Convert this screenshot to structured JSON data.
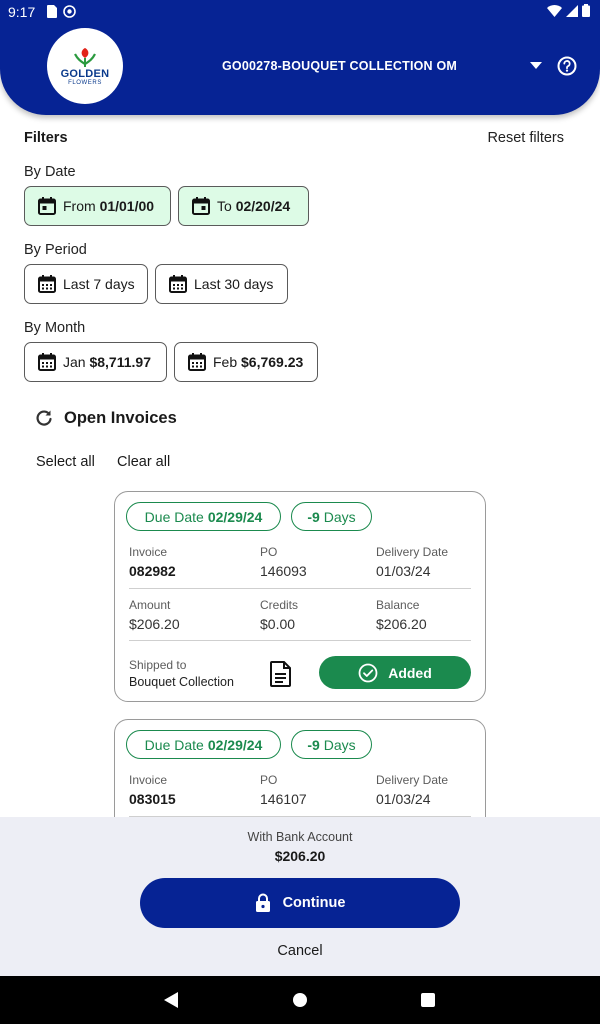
{
  "status_bar": {
    "time": "9:17"
  },
  "header": {
    "logo_line1": "GOLDEN",
    "logo_line2": "FLOWERS",
    "account_title": "GO00278-BOUQUET COLLECTION OM"
  },
  "filters": {
    "title": "Filters",
    "reset_label": "Reset filters",
    "by_date_label": "By Date",
    "date_from_prefix": "From",
    "date_from_value": "01/01/00",
    "date_to_prefix": "To",
    "date_to_value": "02/20/24",
    "by_period_label": "By Period",
    "period_7": "Last 7 days",
    "period_30": "Last 30 days",
    "by_month_label": "By Month",
    "month_jan_name": "Jan",
    "month_jan_amount": "$8,711.97",
    "month_feb_name": "Feb",
    "month_feb_amount": "$6,769.23"
  },
  "invoices_section": {
    "title": "Open Invoices",
    "select_all": "Select all",
    "clear_all": "Clear all"
  },
  "invoices": [
    {
      "due_prefix": "Due Date",
      "due_date": "02/29/24",
      "days": "-9",
      "days_label": "Days",
      "invoice_label": "Invoice",
      "invoice": "082982",
      "po_label": "PO",
      "po": "146093",
      "delivery_label": "Delivery Date",
      "delivery": "01/03/24",
      "amount_label": "Amount",
      "amount": "$206.20",
      "credits_label": "Credits",
      "credits": "$0.00",
      "balance_label": "Balance",
      "balance": "$206.20",
      "shipped_label": "Shipped to",
      "shipped_to": "Bouquet Collection",
      "action_label": "Added"
    },
    {
      "due_prefix": "Due Date",
      "due_date": "02/29/24",
      "days": "-9",
      "days_label": "Days",
      "invoice_label": "Invoice",
      "invoice": "083015",
      "po_label": "PO",
      "po": "146107",
      "delivery_label": "Delivery Date",
      "delivery": "01/03/24"
    }
  ],
  "footer": {
    "payment_method": "With Bank Account",
    "total": "$206.20",
    "continue_label": "Continue",
    "cancel_label": "Cancel"
  },
  "colors": {
    "primary": "#062394",
    "success": "#1b8a4e",
    "chip_active_bg": "#ddfbe6",
    "panel_bg": "#edeef5"
  },
  "icons": [
    "calendar-icon",
    "refresh-icon",
    "document-icon",
    "check-circle-icon",
    "lock-icon",
    "help-icon",
    "dropdown-icon"
  ]
}
